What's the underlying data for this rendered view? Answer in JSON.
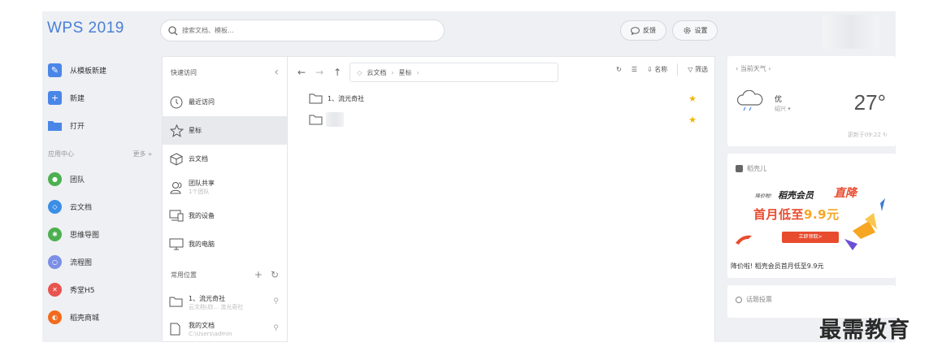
{
  "app": {
    "title": "WPS 2019"
  },
  "search": {
    "placeholder": "搜索文档、模板..."
  },
  "topbar": {
    "feedback_label": "反馈",
    "settings_label": "设置"
  },
  "left_nav": {
    "primary": [
      {
        "label": "从模板新建",
        "icon": "template-new-icon",
        "color": "#4a86e8"
      },
      {
        "label": "新建",
        "icon": "plus-icon",
        "color": "#4a86e8"
      },
      {
        "label": "打开",
        "icon": "folder-open-icon",
        "color": "#4a86e8"
      }
    ],
    "app_center_label": "应用中心",
    "more_label": "更多 »",
    "apps": [
      {
        "label": "团队",
        "icon": "team-icon",
        "color": "#4cb050"
      },
      {
        "label": "云文档",
        "icon": "cloud-doc-icon",
        "color": "#3a8ee6"
      },
      {
        "label": "思维导图",
        "icon": "mindmap-icon",
        "color": "#4cb050"
      },
      {
        "label": "流程图",
        "icon": "flowchart-icon",
        "color": "#7b8fe6"
      },
      {
        "label": "秀堂H5",
        "icon": "h5-icon",
        "color": "#e8544f"
      },
      {
        "label": "稻壳商城",
        "icon": "store-icon",
        "color": "#f26b1d"
      }
    ]
  },
  "quick_access": {
    "title": "快速访问",
    "items": [
      {
        "label": "最近访问",
        "icon": "clock-icon"
      },
      {
        "label": "星标",
        "icon": "star-outline-icon"
      },
      {
        "label": "云文档",
        "icon": "cube-icon"
      },
      {
        "label": "团队共享",
        "sub": "1个团队",
        "icon": "users-icon"
      },
      {
        "label": "我的设备",
        "icon": "devices-icon"
      },
      {
        "label": "我的电脑",
        "icon": "monitor-icon"
      }
    ],
    "common_title": "常用位置",
    "common": [
      {
        "label": "1、流光奇社",
        "sub": "云文档\\欣... 流光奇社"
      },
      {
        "label": "我的文档",
        "sub": "C:\\Users\\admin"
      }
    ]
  },
  "breadcrumb": {
    "root": "云文档",
    "current": "星标"
  },
  "toolbar": {
    "sort_label": "名称",
    "filter_label": "筛选"
  },
  "files": [
    {
      "name": "1、流光奇社",
      "starred": true
    },
    {
      "name": "",
      "starred": true
    }
  ],
  "weather": {
    "header": "当前天气",
    "condition": "优",
    "city": "绍兴 ▾",
    "temp": "27°",
    "updated": "更新于09:22"
  },
  "promo": {
    "title": "稻壳儿",
    "small": "降价啦!",
    "vip": "稻壳会员",
    "down": "直降",
    "main_prefix": "首月低至",
    "main_price": "9.9元",
    "button": "立即领取>",
    "footer": "降价啦! 稻壳会员首月低至9.9元"
  },
  "topic": {
    "title": "话题投票"
  },
  "watermark": "最需教育"
}
